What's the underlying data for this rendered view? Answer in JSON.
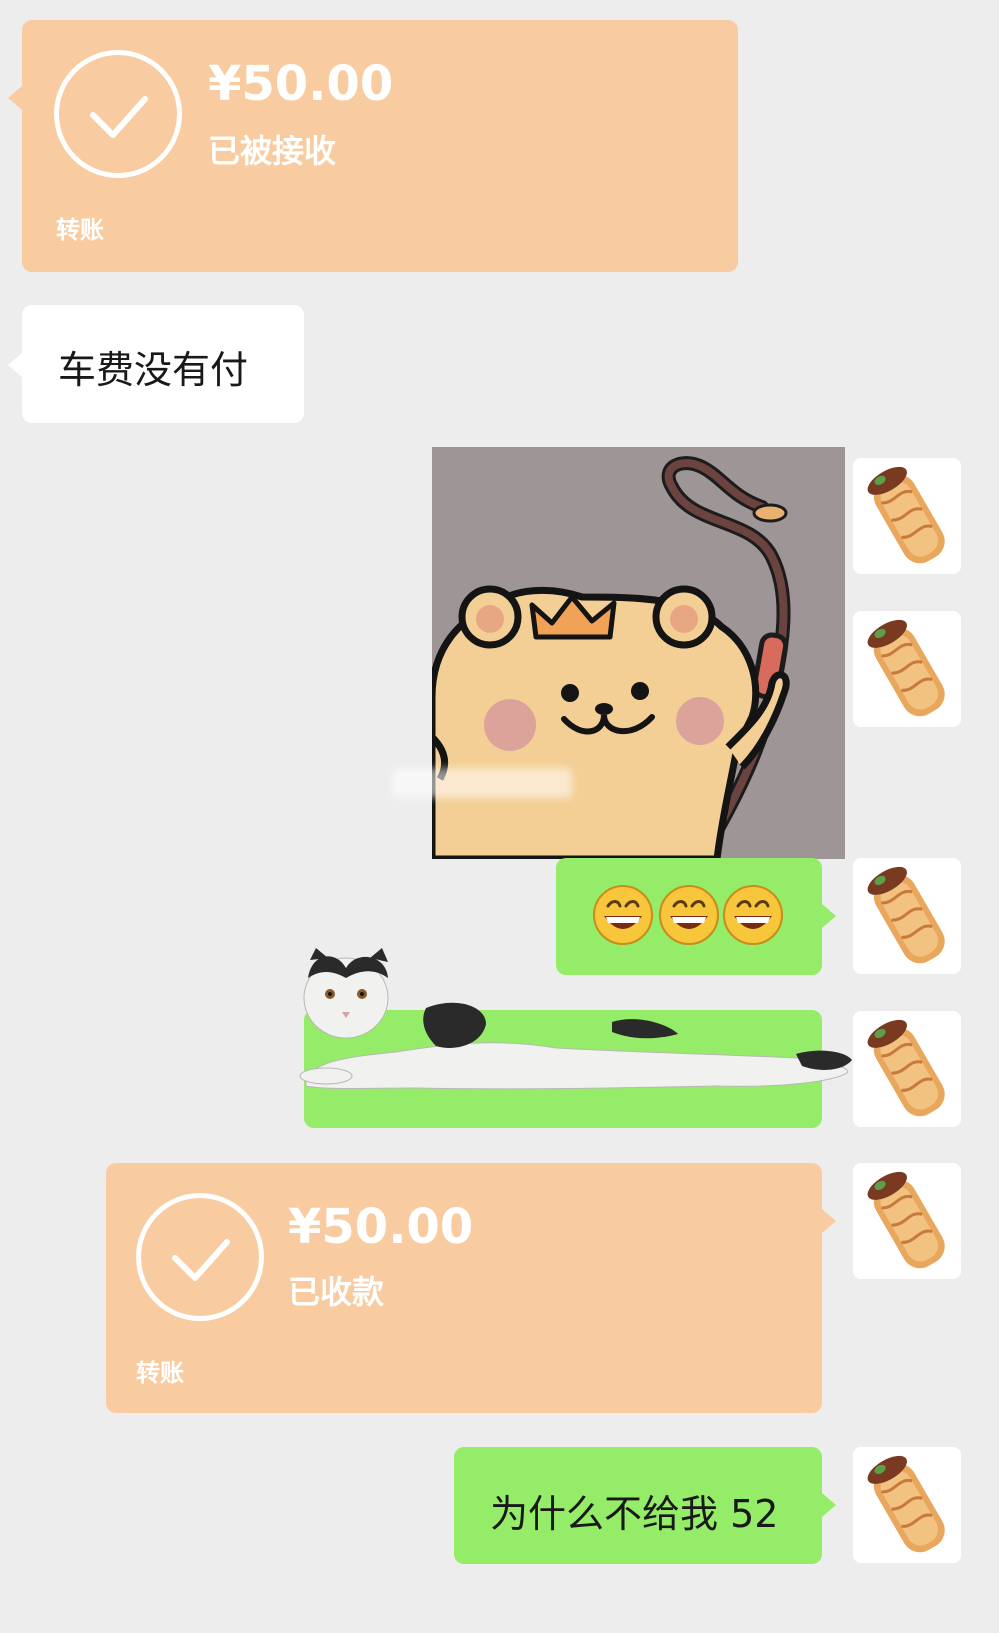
{
  "messages": {
    "transfer_received": {
      "amount": "¥50.00",
      "status": "已被接收",
      "kind": "转账",
      "color": "#f8cca0"
    },
    "text_fare": {
      "text": "车费没有付"
    },
    "sticker_bear": {
      "icon": "bear-with-whip-sticker"
    },
    "emoji_row": {
      "icon": "grinning-face-emoji",
      "count": 3
    },
    "sticker_cat": {
      "icon": "lying-cat-sticker"
    },
    "transfer_collected": {
      "amount": "¥50.00",
      "status": "已收款",
      "kind": "转账",
      "color": "#f8cca0"
    },
    "text_why": {
      "text": "为什么不给我 52"
    }
  },
  "avatar": {
    "icon": "crepe-roll-avatar"
  },
  "colors": {
    "background": "#ededed",
    "green_bubble": "#95ec69",
    "white_bubble": "#ffffff",
    "transfer_bubble": "#f8cca0"
  }
}
